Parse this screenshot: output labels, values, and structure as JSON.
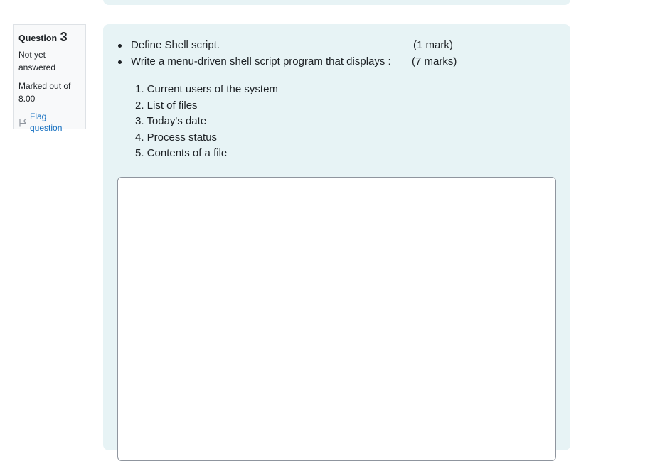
{
  "question": {
    "title_label": "Question",
    "number": "3",
    "state": "Not yet answered",
    "grade": "Marked out of 8.00",
    "flag_label": "Flag question"
  },
  "content": {
    "bullets": [
      {
        "text": "Define Shell script.",
        "marks": "(1 mark)"
      },
      {
        "text": "Write a menu-driven shell script program that displays :",
        "marks": "(7 marks)"
      }
    ],
    "menu_items": [
      "1. Current users of the system",
      "2. List of files",
      "3. Today's date",
      "4. Process status",
      "5. Contents of a file"
    ],
    "answer_value": ""
  },
  "colors": {
    "panel_bg": "#e7f3f5",
    "info_bg": "#f8f9fa",
    "link": "#0f6cbf",
    "text": "#1d2125"
  },
  "icons": {
    "flag": "flag-icon"
  }
}
